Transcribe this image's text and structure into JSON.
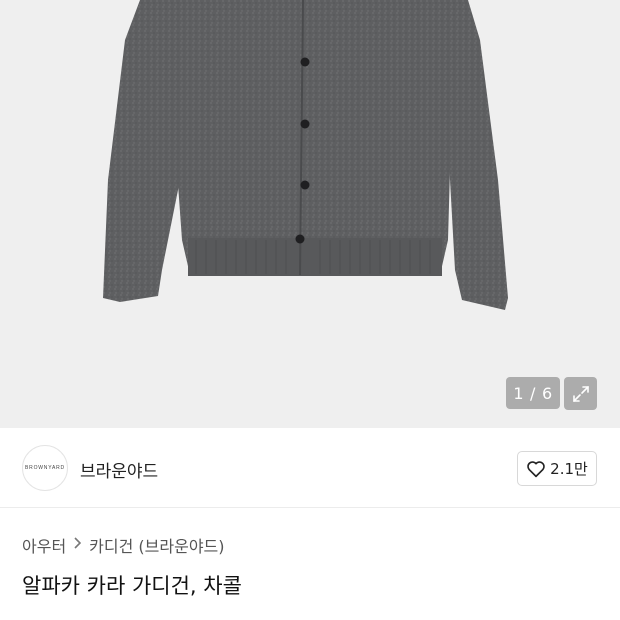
{
  "gallery": {
    "current_page": "1",
    "separator": "/",
    "total_pages": "6",
    "expand_icon": "expand-icon"
  },
  "seller": {
    "logo_text": "BROWNYARD",
    "name": "브라운야드",
    "like_icon": "heart-icon",
    "like_count": "2.1만"
  },
  "breadcrumb": {
    "items": [
      "아우터",
      "카디건 (브라운야드)"
    ],
    "chevron_icon": "chevron-right-icon"
  },
  "product": {
    "title": "알파카 카라 가디건, 차콜"
  }
}
